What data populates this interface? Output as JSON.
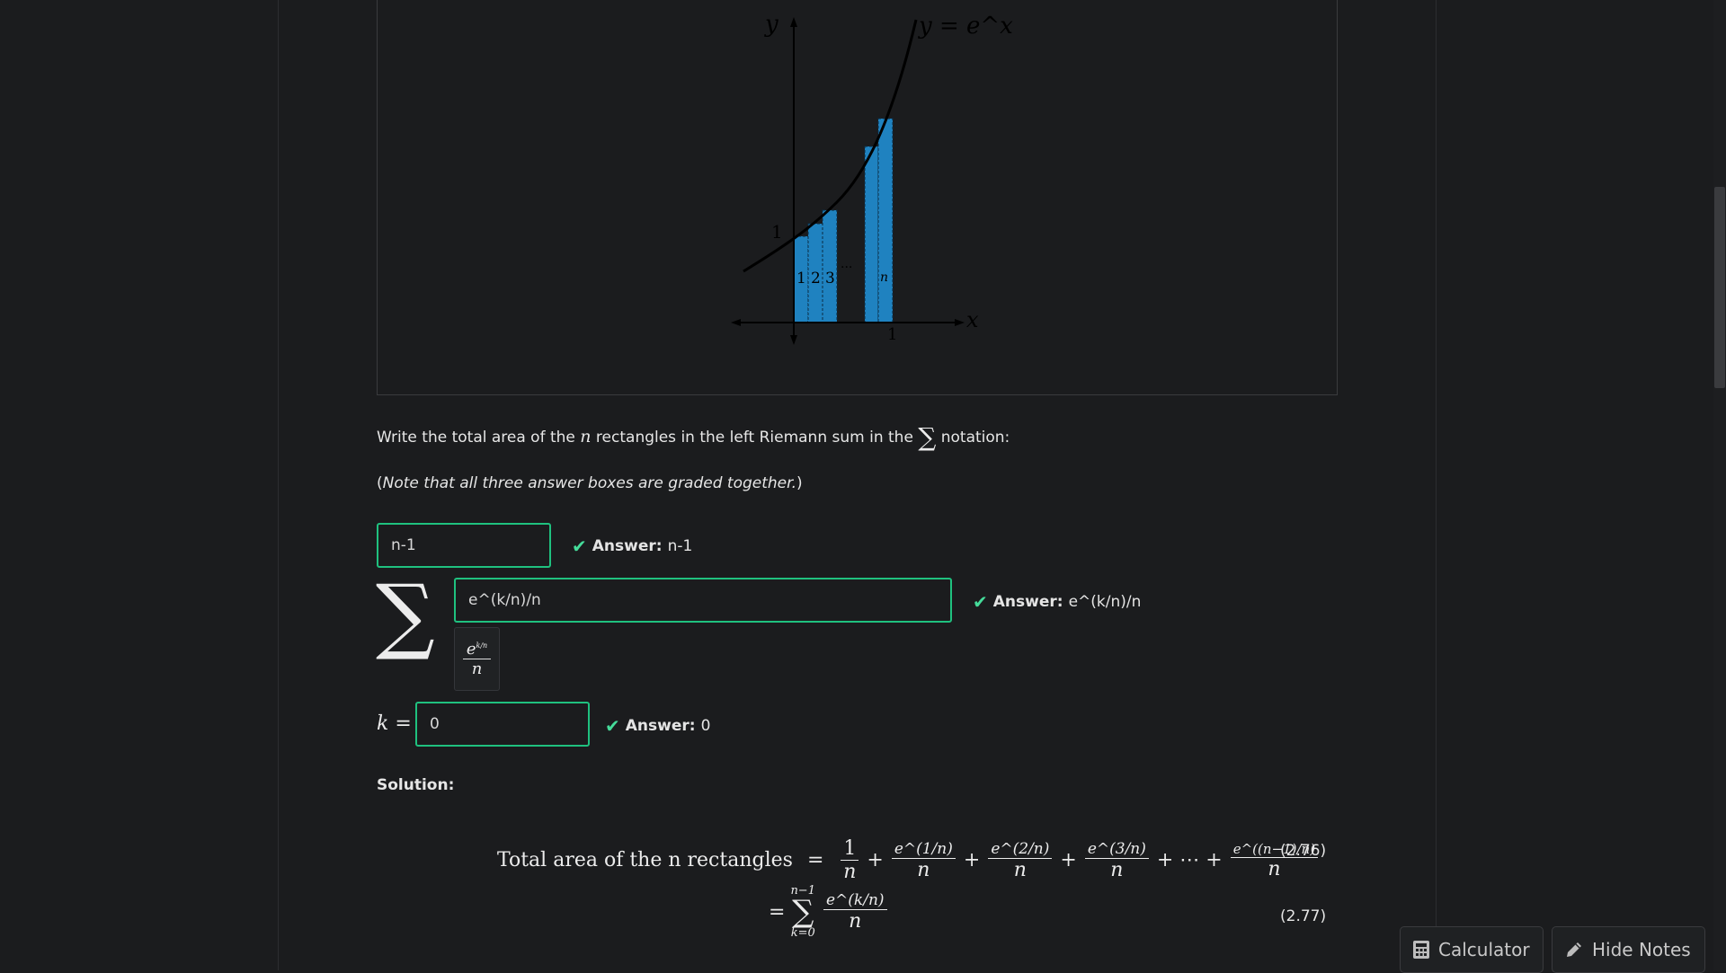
{
  "figure": {
    "y_label": "y",
    "x_label": "x",
    "curve_label": "y = e^x",
    "one_y": "1",
    "one_x": "1",
    "bar_labels": [
      "1",
      "2",
      "3"
    ],
    "dots": "···",
    "last_label": "n"
  },
  "prompt": {
    "before": "Write the total area of the ",
    "n": "n",
    "middle": " rectangles in the left Riemann sum in the ",
    "sigma": "∑",
    "after": " notation:"
  },
  "note": {
    "open": "(",
    "text": "Note that all three answer boxes are graded together.",
    "close": ")"
  },
  "answers": [
    {
      "value": "n-1",
      "label": "Answer:",
      "answer": "n-1"
    },
    {
      "value": "e^(k/n)/n",
      "label": "Answer:",
      "answer": "e^(k/n)/n"
    },
    {
      "value": "0",
      "label": "Answer:",
      "answer": "0"
    }
  ],
  "sum_symbol": "∑",
  "preview": {
    "base": "e",
    "exp": "k/n",
    "den": "n"
  },
  "k_label": "k =",
  "solution": {
    "title": "Solution:",
    "lhs": "Total area of the n rectangles",
    "eq": "=",
    "eq1_tag": "(2.76)",
    "eq2_tag": "(2.77)",
    "terms": [
      "1",
      "e^(1/n)",
      "e^(2/n)",
      "e^(3/n)",
      "e^((n−1)/n)"
    ],
    "den": "n",
    "ellipsis": "+ ⋯ +",
    "plus": "+",
    "upper": "n−1",
    "lower": "k=0",
    "sum_term": "e^(k/n)"
  },
  "buttons": {
    "calculator": "Calculator",
    "hide_notes": "Hide Notes"
  },
  "colors": {
    "accent": "#1fc17f",
    "check": "#45dc9a",
    "bar": "#1f82c0"
  }
}
